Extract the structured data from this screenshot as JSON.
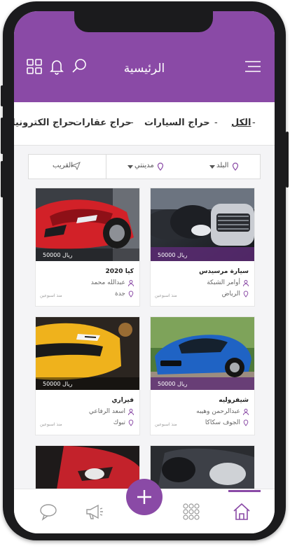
{
  "header": {
    "title": "الرئيسية"
  },
  "tabs": [
    {
      "label": "الكل",
      "active": true
    },
    {
      "label": "حراج السيارات",
      "active": false
    },
    {
      "label": "حراج عقارات",
      "active": false
    },
    {
      "label": "حراج الكترونيات",
      "active": false
    }
  ],
  "filters": {
    "country": "البلد",
    "city": "مدينتي",
    "nearby": "القريب"
  },
  "cards": [
    {
      "title": "سيارة مرسيدس",
      "user": "أوامر الشبكة",
      "location": "الرياض",
      "price": "50000 ريال",
      "time": "منذ اسبوعين"
    },
    {
      "title": "كيا 2020",
      "user": "عبدالله محمد",
      "location": "جدة",
      "price": "50000 ريال",
      "time": "منذ اسبوعين"
    },
    {
      "title": "شيفروليه",
      "user": "عبدالرحمن وهيبه",
      "location": "الجوف سكاكا",
      "price": "50000 ريال",
      "time": "منذ اسبوعين"
    },
    {
      "title": "فيراري",
      "user": "اسعد الرفاعي",
      "location": "تبوك",
      "price": "50000 ريال",
      "time": "منذ اسبوعين"
    }
  ],
  "colors": {
    "accent": "#8a4aa6",
    "header_bg": "#8a4aa6"
  }
}
